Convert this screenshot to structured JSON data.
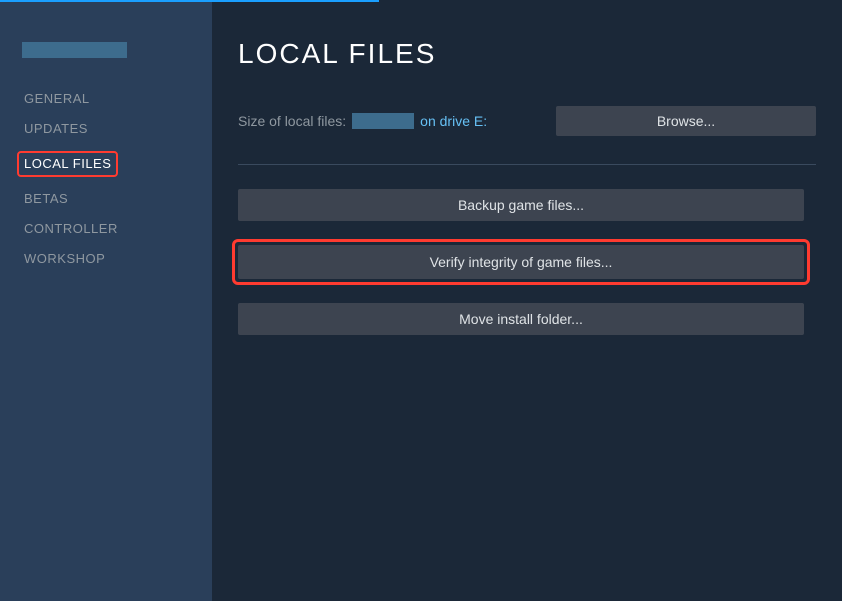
{
  "sidebar": {
    "items": [
      {
        "label": "GENERAL",
        "active": false
      },
      {
        "label": "UPDATES",
        "active": false
      },
      {
        "label": "LOCAL FILES",
        "active": true
      },
      {
        "label": "BETAS",
        "active": false
      },
      {
        "label": "CONTROLLER",
        "active": false
      },
      {
        "label": "WORKSHOP",
        "active": false
      }
    ]
  },
  "page": {
    "title": "LOCAL FILES",
    "size_label": "Size of local files:",
    "drive_label": "on drive E:",
    "browse_label": "Browse...",
    "backup_label": "Backup game files...",
    "verify_label": "Verify integrity of game files...",
    "move_label": "Move install folder..."
  }
}
